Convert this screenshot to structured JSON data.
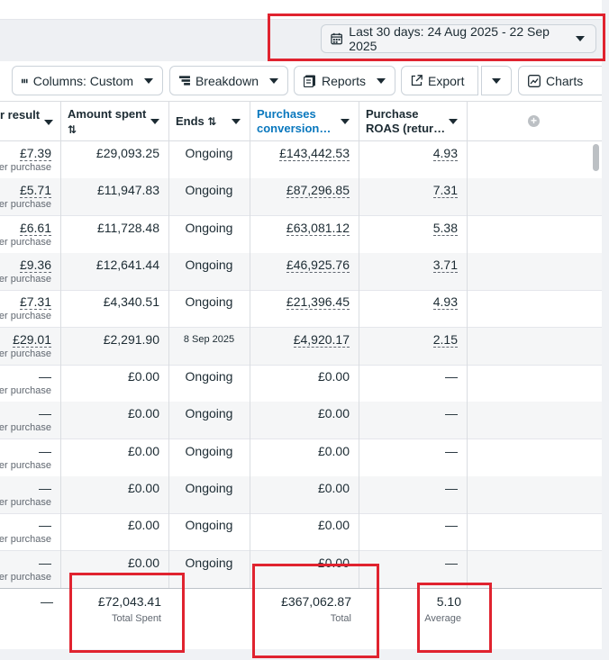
{
  "date_range": {
    "label": "Last 30 days: 24 Aug 2025 - 22 Sep 2025"
  },
  "toolbar": {
    "columns_label": "Columns: Custom",
    "breakdown_label": "Breakdown",
    "reports_label": "Reports",
    "export_label": "Export",
    "charts_label": "Charts"
  },
  "table": {
    "headers": {
      "cost_per_result": "r result",
      "amount_spent": "Amount spent",
      "ends": "Ends",
      "purchases_conversion_line1": "Purchases",
      "purchases_conversion_line2": "conversion…",
      "purchase_roas_line1": "Purchase",
      "purchase_roas_line2": "ROAS (retur…"
    },
    "rows": [
      {
        "cost": "£7.39",
        "cost_sub": "er purchase",
        "spent": "£29,093.25",
        "ends": "Ongoing",
        "conv": "£143,442.53",
        "roas": "4.93"
      },
      {
        "cost": "£5.71",
        "cost_sub": "er purchase",
        "spent": "£11,947.83",
        "ends": "Ongoing",
        "conv": "£87,296.85",
        "roas": "7.31"
      },
      {
        "cost": "£6.61",
        "cost_sub": "er purchase",
        "spent": "£11,728.48",
        "ends": "Ongoing",
        "conv": "£63,081.12",
        "roas": "5.38"
      },
      {
        "cost": "£9.36",
        "cost_sub": "er purchase",
        "spent": "£12,641.44",
        "ends": "Ongoing",
        "conv": "£46,925.76",
        "roas": "3.71"
      },
      {
        "cost": "£7.31",
        "cost_sub": "er purchase",
        "spent": "£4,340.51",
        "ends": "Ongoing",
        "conv": "£21,396.45",
        "roas": "4.93"
      },
      {
        "cost": "£29.01",
        "cost_sub": "er purchase",
        "spent": "£2,291.90",
        "ends": "8 Sep 2025",
        "conv": "£4,920.17",
        "roas": "2.15"
      },
      {
        "cost": "—",
        "cost_sub": "Per purchase",
        "spent": "£0.00",
        "ends": "Ongoing",
        "conv": "£0.00",
        "roas": "—"
      },
      {
        "cost": "—",
        "cost_sub": "Per purchase",
        "spent": "£0.00",
        "ends": "Ongoing",
        "conv": "£0.00",
        "roas": "—"
      },
      {
        "cost": "—",
        "cost_sub": "Per purchase",
        "spent": "£0.00",
        "ends": "Ongoing",
        "conv": "£0.00",
        "roas": "—"
      },
      {
        "cost": "—",
        "cost_sub": "Per purchase",
        "spent": "£0.00",
        "ends": "Ongoing",
        "conv": "£0.00",
        "roas": "—"
      },
      {
        "cost": "—",
        "cost_sub": "Per purchase",
        "spent": "£0.00",
        "ends": "Ongoing",
        "conv": "£0.00",
        "roas": "—"
      },
      {
        "cost": "—",
        "cost_sub": "Per purchase",
        "spent": "£0.00",
        "ends": "Ongoing",
        "conv": "£0.00",
        "roas": "—"
      }
    ],
    "totals": {
      "cost": "—",
      "spent": "£72,043.41",
      "spent_sub": "Total Spent",
      "conv": "£367,062.87",
      "conv_sub": "Total",
      "roas": "5.10",
      "roas_sub": "Average"
    }
  },
  "colors": {
    "highlight_box": "#e0232f",
    "link_blue": "#0a78be"
  }
}
